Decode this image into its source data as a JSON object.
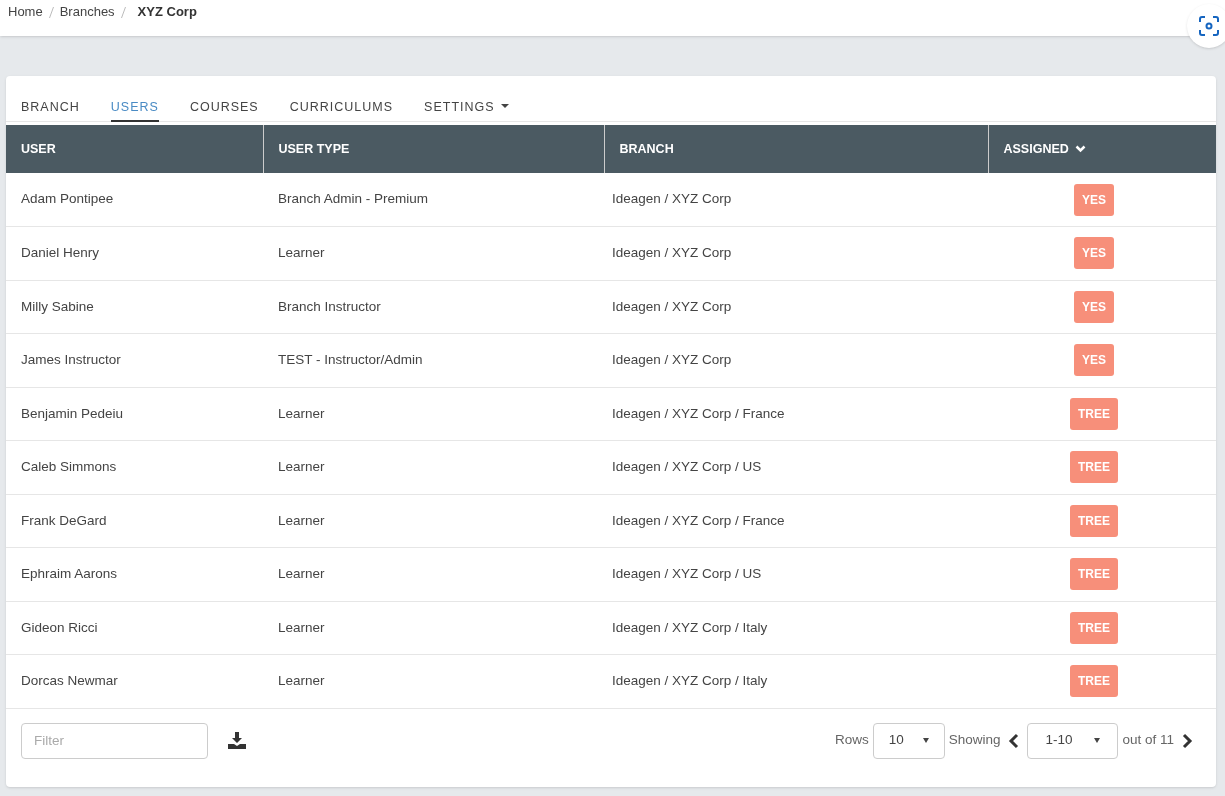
{
  "breadcrumb": [
    {
      "label": "Home",
      "current": false
    },
    {
      "label": "Branches",
      "current": false
    },
    {
      "label": "XYZ Corp",
      "current": true
    }
  ],
  "tabs": [
    {
      "label": "BRANCH",
      "selected": false,
      "dropdown": false
    },
    {
      "label": "USERS",
      "selected": true,
      "dropdown": false
    },
    {
      "label": "COURSES",
      "selected": false,
      "dropdown": false
    },
    {
      "label": "CURRICULUMS",
      "selected": false,
      "dropdown": false
    },
    {
      "label": "SETTINGS",
      "selected": false,
      "dropdown": true
    }
  ],
  "table": {
    "columns": [
      "USER",
      "USER TYPE",
      "BRANCH",
      "ASSIGNED"
    ],
    "rows": [
      {
        "user": "Adam Pontipee",
        "user_type": "Branch Admin - Premium",
        "branch": "Ideagen / XYZ Corp",
        "assigned": "YES"
      },
      {
        "user": "Daniel Henry",
        "user_type": "Learner",
        "branch": "Ideagen / XYZ Corp",
        "assigned": "YES"
      },
      {
        "user": "Milly Sabine",
        "user_type": "Branch Instructor",
        "branch": "Ideagen / XYZ Corp",
        "assigned": "YES"
      },
      {
        "user": "James Instructor",
        "user_type": "TEST - Instructor/Admin",
        "branch": "Ideagen / XYZ Corp",
        "assigned": "YES"
      },
      {
        "user": "Benjamin Pedeiu",
        "user_type": "Learner",
        "branch": "Ideagen / XYZ Corp / France",
        "assigned": "TREE"
      },
      {
        "user": "Caleb Simmons",
        "user_type": "Learner",
        "branch": "Ideagen / XYZ Corp / US",
        "assigned": "TREE"
      },
      {
        "user": "Frank DeGard",
        "user_type": "Learner",
        "branch": "Ideagen / XYZ Corp / France",
        "assigned": "TREE"
      },
      {
        "user": "Ephraim Aarons",
        "user_type": "Learner",
        "branch": "Ideagen / XYZ Corp / US",
        "assigned": "TREE"
      },
      {
        "user": "Gideon Ricci",
        "user_type": "Learner",
        "branch": "Ideagen / XYZ Corp / Italy",
        "assigned": "TREE"
      },
      {
        "user": "Dorcas Newmar",
        "user_type": "Learner",
        "branch": "Ideagen / XYZ Corp / Italy",
        "assigned": "TREE"
      }
    ]
  },
  "footer": {
    "filter": {
      "placeholder": "Filter"
    },
    "rows_label": "Rows",
    "rows_value": "10",
    "showing_label": "Showing",
    "page_value": "1-10",
    "total": "out of 11"
  }
}
